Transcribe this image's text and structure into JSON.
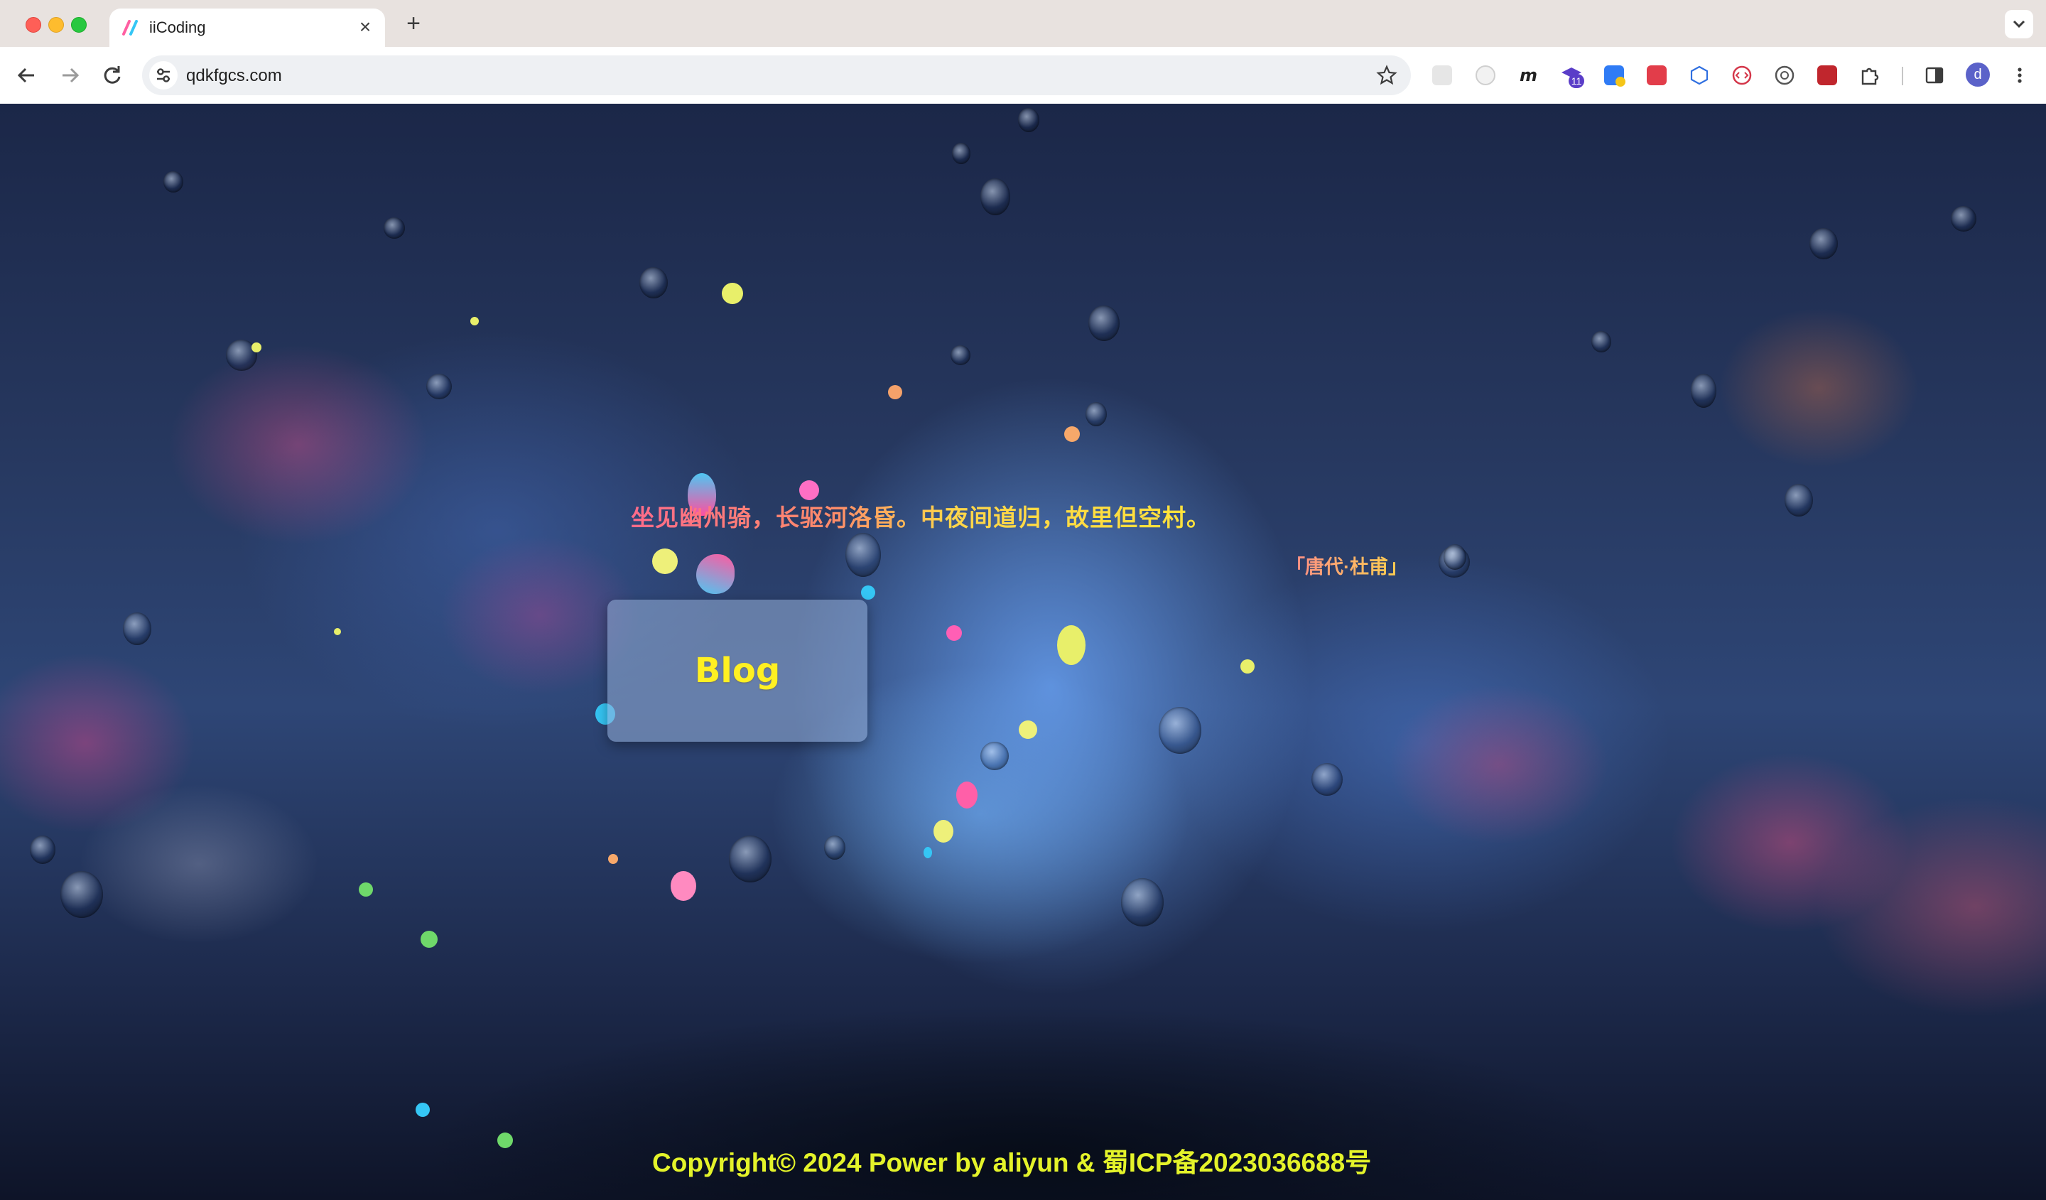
{
  "browser": {
    "tab_title": "iiCoding",
    "url": "qdkfgcs.com",
    "new_tab_symbol": "+",
    "close_symbol": "×",
    "extension_badge": "11",
    "avatar_letter": "d"
  },
  "page": {
    "poem": "坐见幽州骑，长驱河洛昏。中夜间道归，故里但空村。",
    "poem_author": "「唐代·杜甫」",
    "blog_button": "Blog",
    "footer": "Copyright© 2024 Power by aliyun & 蜀ICP备2023036688号"
  },
  "colors": {
    "accent_yellow": "#fff022",
    "accent_pink": "#ff6b8a",
    "footer_text": "#e4f32a",
    "background": "#26375e"
  }
}
